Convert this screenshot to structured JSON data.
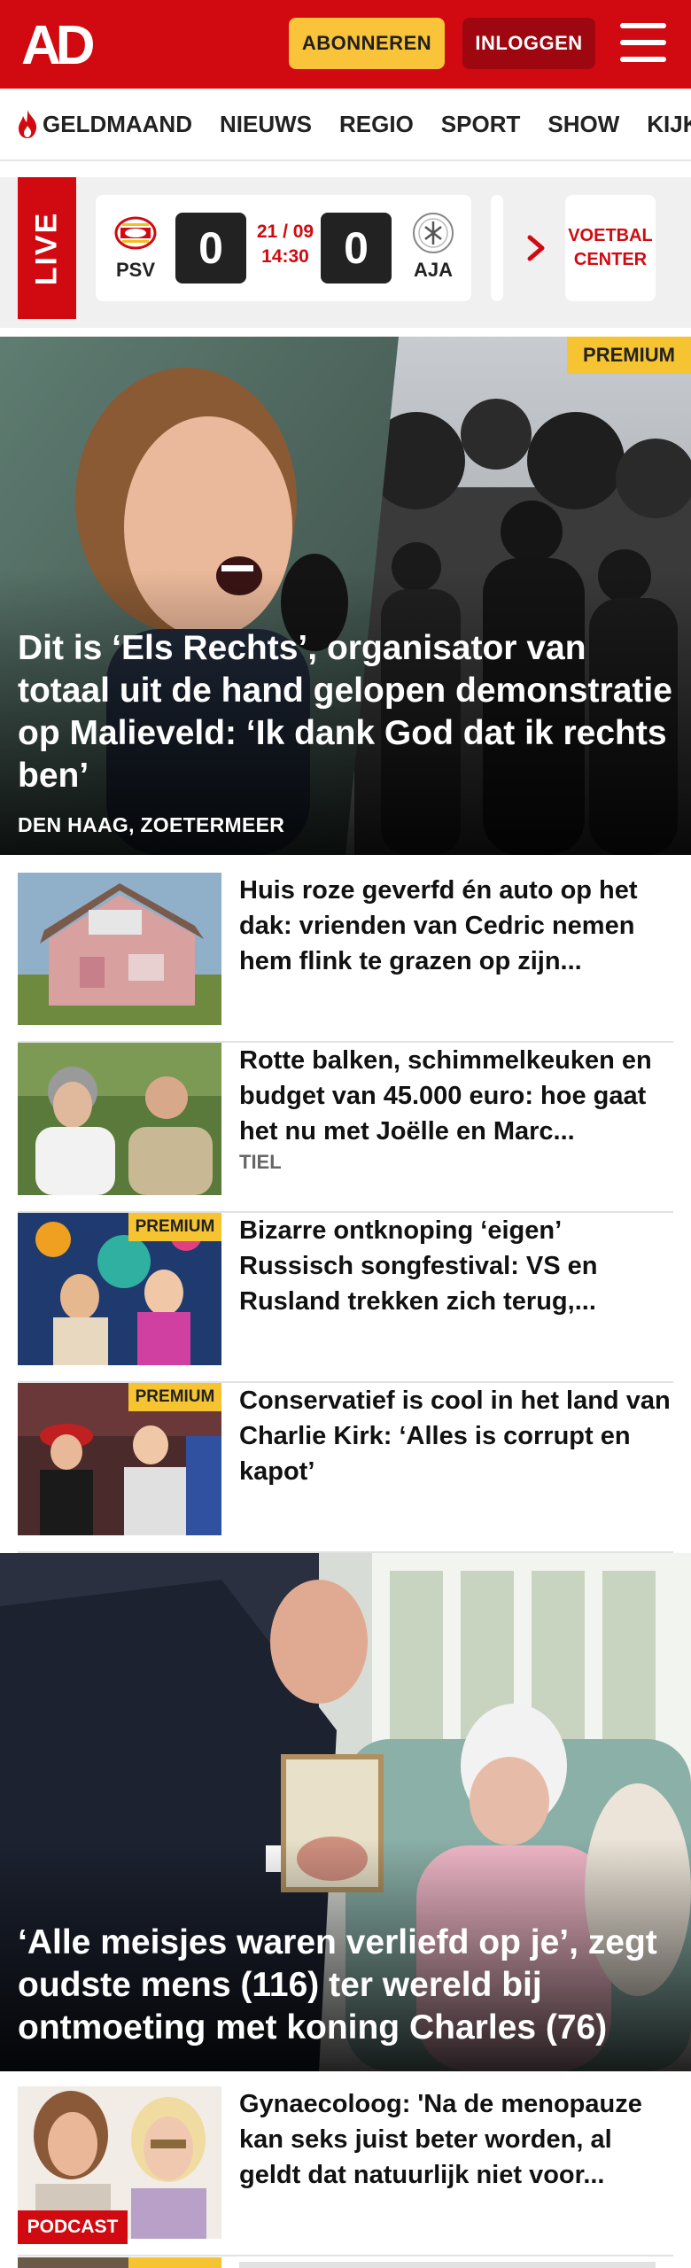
{
  "header": {
    "logo_text": "AD",
    "subscribe_label": "ABONNEREN",
    "login_label": "INLOGGEN",
    "menu_icon": "hamburger-icon"
  },
  "nav": {
    "items": [
      "GELDMAAND",
      "NIEUWS",
      "REGIO",
      "SPORT",
      "SHOW",
      "KIJK"
    ]
  },
  "live": {
    "tag": "LIVE",
    "match": {
      "home_team": "PSV",
      "away_team": "AJA",
      "home_score": "0",
      "away_score": "0",
      "date": "21 / 09",
      "time": "14:30"
    },
    "center_label_1": "VOETBAL",
    "center_label_2": "CENTER"
  },
  "hero": {
    "badge": "PREMIUM",
    "title": "Dit is ‘Els Rechts’, organisator van totaal uit de hand gelopen demonstra­tie op Malieveld: ‘Ik dank God dat ik rechts ben’",
    "location": "DEN HAAG, ZOETERMEER"
  },
  "articles": [
    {
      "title": "Huis roze geverfd én auto op het dak: vrienden van Cedric nemen hem flink te grazen op zijn...",
      "location": "",
      "badge": ""
    },
    {
      "title": "Rotte balken, schimmelkeuken en budget van 45.000 euro: hoe gaat het nu met Joëlle en Marc...",
      "location": "TIEL",
      "badge": ""
    },
    {
      "title": "Bizarre ontknoping ‘eigen’ Russisch songfestival: VS en Rusland trekken zich terug,...",
      "location": "",
      "badge": "PREMIUM"
    },
    {
      "title": "Conservatief is cool in het land van Charlie Kirk: ‘Alles is corrupt en kapot’",
      "location": "",
      "badge": "PREMIUM"
    }
  ],
  "hero2": {
    "title": "‘Alle meisjes waren verliefd op je’, zegt oudste mens (116) ter wereld bij ontmoeting met koning Charles (76)"
  },
  "podcast_item": {
    "title": "Gynaecoloog: 'Na de menopauze kan seks juist beter worden, al geldt dat natuurlijk niet voor...",
    "badge": "PODCAST"
  },
  "last_item": {
    "badge": "PREMIUM"
  },
  "colors": {
    "brand_red": "#d10a11",
    "dark_red": "#9e0610",
    "premium_yellow": "#f5c430",
    "subscribe_yellow": "#f9c33a"
  }
}
